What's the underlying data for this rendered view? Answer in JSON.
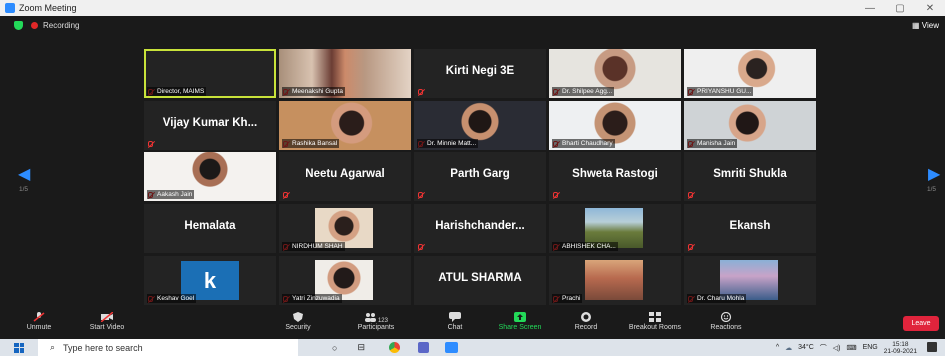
{
  "window": {
    "title": "Zoom Meeting",
    "ctrl_min": "—",
    "ctrl_max": "▢",
    "ctrl_close": "✕"
  },
  "topbar": {
    "recording": "Recording",
    "view": "View"
  },
  "pager": {
    "left": "1/5",
    "right": "1/5"
  },
  "participants": [
    {
      "label": "Director, MAIMS"
    },
    {
      "label": "Meenakshi Gupta"
    },
    {
      "bigname": "Kirti Negi 3E"
    },
    {
      "label": "Dr. Shilpee Agg..."
    },
    {
      "label": "PRIYANSHU GU..."
    },
    {
      "bigname": "Vijay Kumar Kh..."
    },
    {
      "label": "Rashika Bansal"
    },
    {
      "label": "Dr. Minnie Matt..."
    },
    {
      "label": "Bharti Chaudhary"
    },
    {
      "label": "Manisha Jain"
    },
    {
      "label": "Aakash Jain"
    },
    {
      "bigname": "Neetu Agarwal"
    },
    {
      "bigname": "Parth Garg"
    },
    {
      "bigname": "Shweta Rastogi"
    },
    {
      "bigname": "Smriti Shukla"
    },
    {
      "bigname": "Hemalata"
    },
    {
      "label": "NIRDHUM SHAH"
    },
    {
      "bigname": "Harishchander..."
    },
    {
      "label": "ABHISHEK CHA..."
    },
    {
      "bigname": "Ekansh"
    },
    {
      "label": "Keshav Goel",
      "avatar_letter": "k"
    },
    {
      "label": "Yatri Zinzuwadia"
    },
    {
      "bigname": "ATUL SHARMA"
    },
    {
      "label": "Prachi"
    },
    {
      "label": "Dr. Charu Mohla"
    }
  ],
  "toolbar": {
    "unmute": "Unmute",
    "start_video": "Start Video",
    "security": "Security",
    "participants": "Participants",
    "participant_count": "123",
    "chat": "Chat",
    "share_screen": "Share Screen",
    "record": "Record",
    "breakout_rooms": "Breakout Rooms",
    "reactions": "Reactions",
    "leave": "Leave"
  },
  "taskbar": {
    "search_placeholder": "Type here to search",
    "temperature": "34°C",
    "language": "ENG",
    "time": "15:18",
    "date": "21-09-2021"
  },
  "colors": {
    "active_speaker": "#c8e23a",
    "accent": "#2d8cff",
    "leave": "#e0243c",
    "share": "#23d959"
  }
}
